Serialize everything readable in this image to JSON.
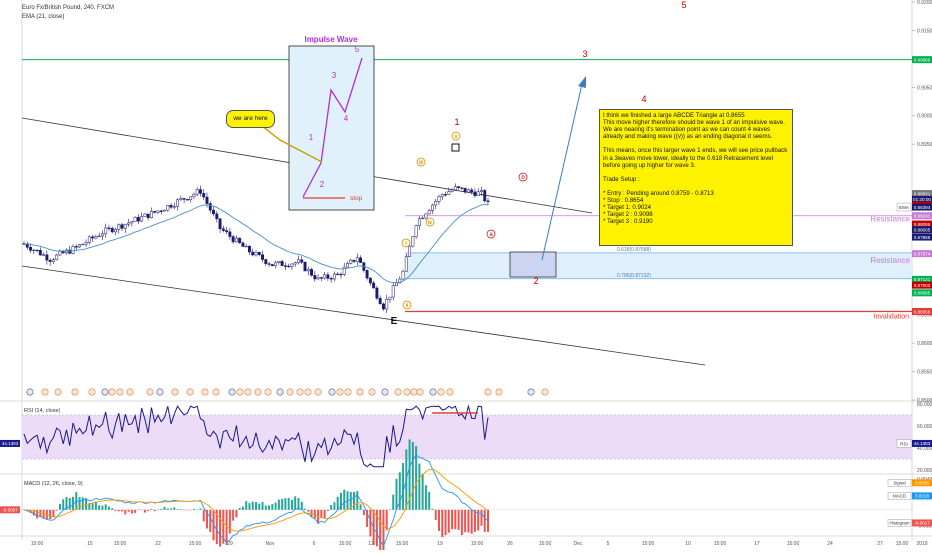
{
  "header": {
    "symbol": "Euro Fx/British Pound, 240, FXCM",
    "indicator": "EMA (21, close)"
  },
  "colors": {
    "up_candle": "#26a69a",
    "down_candle": "#1a1a6e",
    "candle_body": "#1a1a6e",
    "ema": "#4a90c8",
    "green_line": "#00b050",
    "red_line": "#e53935",
    "resistance": "#c87ad8",
    "rsi_line": "#1a1a8c",
    "rsi_band": "#ecdcf7",
    "macd_line": "#2196f3",
    "signal_line": "#ff9800",
    "hist_up": "#26a69a",
    "hist_down": "#ef5350",
    "wave_purple": "#b22fd6",
    "wave_red": "#c00000",
    "callout_yellow": "#fff200"
  },
  "annotations": {
    "impulse_title": "Impulse Wave",
    "impulse_labels": [
      "1",
      "2",
      "3",
      "4",
      "5"
    ],
    "stop_label": "stop",
    "we_are_here": "we are here",
    "big_wave_labels": [
      "1",
      "2",
      "3",
      "4",
      "5"
    ],
    "abc_labels": [
      "a",
      "b",
      "c"
    ],
    "sub_labels": [
      "i",
      "ii",
      "iii",
      "iv",
      "v"
    ],
    "e_label": "E",
    "resistance_1": "Resistance",
    "resistance_2": "Resistance",
    "invalidation": "Invalidation",
    "fib_618": "0.618(0.87588)",
    "fib_786": "0.786(0.87132)",
    "note_text": "I think we finished a large ABCDE Triangle at 0.8655\nThis move higher therefore should be wave 1 of an impulsive wave.\nWe are nearing it's termination point as we can count 4 waves already and making wave ((v)) as an ending diagonal it seems.\n\nThis means, once this larger wave 1 ends, we will see price pullback in a 3waves move lower, ideally to the 0.618 Retracement level before going up higher for wave 3.\n\nTrade Setup :\n\n* Entry : Pending around 0.8759 - 0.8713\n* Stop : 0.8654\n* Target 1: 0.9024\n* Target 2 : 0.9098\n* Target 3 : 0.9190"
  },
  "price_axis": {
    "ticks": [
      "0.92000",
      "0.91500",
      "0.90500",
      "0.90000",
      "0.89500",
      "0.88500",
      "0.87000",
      "0.86500",
      "0.86000",
      "0.85500",
      "0.85000"
    ],
    "badges": [
      {
        "text": "0.90986",
        "value": 0.90986,
        "color": "#00b050"
      },
      {
        "text": "0.88441",
        "value": 0.88441,
        "color": "#1a1a6e"
      },
      {
        "text": "0.88631",
        "value": 0.88631,
        "color": "#777777"
      },
      {
        "text": "01:20:00",
        "value": 0.88531,
        "color": "#1a1a6e"
      },
      {
        "text": "0.88500",
        "value": 0.8843,
        "color": "#c00000"
      },
      {
        "text": "0.88241",
        "value": 0.88241,
        "color": "#c87ad8"
      },
      {
        "text": "0.88095",
        "value": 0.88095,
        "color": "#c00000"
      },
      {
        "text": "0.88005",
        "value": 0.87995,
        "color": "#1a1a6e"
      },
      {
        "text": "0.87866",
        "value": 0.87866,
        "color": "#1a1a6e"
      },
      {
        "text": "0.87574",
        "value": 0.87574,
        "color": "#c87ad8"
      },
      {
        "text": "0.87121",
        "value": 0.87121,
        "color": "#00b050"
      },
      {
        "text": "0.87000",
        "value": 0.8702,
        "color": "#c00000"
      },
      {
        "text": "0.86885",
        "value": 0.86885,
        "color": "#00b050"
      },
      {
        "text": "0.86556",
        "value": 0.86556,
        "color": "#e53935"
      }
    ],
    "ema_label": "EMA",
    "ema_value": "0.88394"
  },
  "rsi": {
    "title": "RSI (14, close)",
    "ticks": [
      "80.0000",
      "60.0000",
      "40.0000",
      "20.0000"
    ],
    "value_label": "RSI",
    "value": "44.1383",
    "badge": "44.1383"
  },
  "macd": {
    "title": "MACD (12, 26, close, 9)",
    "ticks": [
      "0.0040",
      "0.0020",
      "-0.0020"
    ],
    "signal_label": "Signal",
    "signal_value": "0.0035",
    "macd_label": "MACD",
    "macd_value": "0.0018",
    "hist_label": "Histogram",
    "hist_value": "-0.0017",
    "zero_badge": "-0.0007"
  },
  "time_axis": {
    "ticks": [
      "15:00",
      "15",
      "15:00",
      "22",
      "15:00",
      "29",
      "Nov",
      "6",
      "15:00",
      "12",
      "15:00",
      "19",
      "15:00",
      "26",
      "15:00",
      "Dec",
      "5",
      "15:00",
      "10",
      "15:00",
      "17",
      "15:00",
      "24",
      "27",
      "15:00",
      "2019"
    ]
  },
  "chart_data": {
    "type": "candlestick",
    "title": "Euro Fx/British Pound, 240, FXCM",
    "timeframe": "240",
    "ylim": [
      0.85,
      0.92
    ],
    "ohlc_anchors": [
      {
        "t": 0,
        "price": 0.8775
      },
      {
        "t": 8,
        "price": 0.8748
      },
      {
        "t": 16,
        "price": 0.8768
      },
      {
        "t": 24,
        "price": 0.8795
      },
      {
        "t": 32,
        "price": 0.8812
      },
      {
        "t": 40,
        "price": 0.883
      },
      {
        "t": 48,
        "price": 0.8852
      },
      {
        "t": 54,
        "price": 0.8868
      },
      {
        "t": 60,
        "price": 0.8802
      },
      {
        "t": 68,
        "price": 0.8765
      },
      {
        "t": 76,
        "price": 0.8738
      },
      {
        "t": 84,
        "price": 0.8742
      },
      {
        "t": 90,
        "price": 0.8712
      },
      {
        "t": 96,
        "price": 0.872
      },
      {
        "t": 102,
        "price": 0.8752
      },
      {
        "t": 106,
        "price": 0.8705
      },
      {
        "t": 110,
        "price": 0.8665
      },
      {
        "t": 116,
        "price": 0.8725
      },
      {
        "t": 120,
        "price": 0.8812
      },
      {
        "t": 124,
        "price": 0.8838
      },
      {
        "t": 128,
        "price": 0.8862
      },
      {
        "t": 132,
        "price": 0.8872
      },
      {
        "t": 136,
        "price": 0.8867
      },
      {
        "t": 140,
        "price": 0.8863
      },
      {
        "t": 142,
        "price": 0.8844
      }
    ],
    "ema21_end": 0.88394,
    "levels": {
      "target_line": 0.90986,
      "resistance": 0.88241,
      "fib_618": 0.87588,
      "fib_786": 0.87132,
      "invalidation": 0.86556
    },
    "rsi": {
      "ylim": [
        20,
        80
      ],
      "band": [
        30,
        70
      ],
      "last": 44.1383
    },
    "macd": {
      "ylim": [
        -0.003,
        0.0045
      ],
      "signal": 0.0035,
      "macd": 0.0018,
      "histogram": -0.0017
    }
  }
}
